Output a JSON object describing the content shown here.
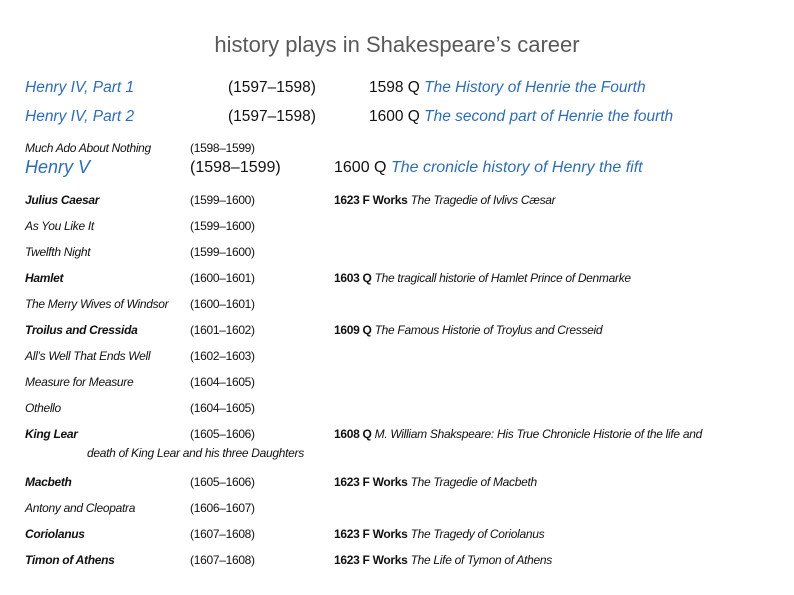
{
  "title": "history plays in Shakespeare’s career",
  "rows": [
    {
      "play": "Henry IV, Part 1",
      "years": "(1597–1598)",
      "prefix": "1598 Q",
      "source_title": "The History of Henrie the Fourth"
    },
    {
      "play": "Henry IV, Part 2",
      "years": "(1597–1598)",
      "prefix": "1600 Q",
      "source_title": "The second part of Henrie the fourth"
    },
    {
      "play": "Much Ado About Nothing",
      "years": "(1598–1599)",
      "prefix": "",
      "source_title": ""
    },
    {
      "play": "Henry V",
      "years": "(1598–1599)",
      "prefix": "1600 Q",
      "source_title": "The cronicle history of Henry the fift"
    },
    {
      "play": "Julius Caesar",
      "years": "(1599–1600)",
      "prefix": "1623 F Works",
      "source_title": "The Tragedie of Ivlivs Cæsar"
    },
    {
      "play": "As You Like It",
      "years": "(1599–1600)",
      "prefix": "",
      "source_title": ""
    },
    {
      "play": "Twelfth Night",
      "years": "(1599–1600)",
      "prefix": "",
      "source_title": ""
    },
    {
      "play": "Hamlet",
      "years": "(1600–1601)",
      "prefix": "1603 Q",
      "source_title": "The tragicall historie of Hamlet Prince of Denmarke"
    },
    {
      "play": "The Merry Wives of Windsor",
      "years": "(1600–1601)",
      "prefix": "",
      "source_title": ""
    },
    {
      "play": "Troilus and Cressida",
      "years": "(1601–1602)",
      "prefix": "1609 Q",
      "source_title": "The Famous Historie of Troylus and Cresseid"
    },
    {
      "play": "All’s Well That Ends Well",
      "years": "(1602–1603)",
      "prefix": "",
      "source_title": ""
    },
    {
      "play": "Measure for Measure",
      "years": "(1604–1605)",
      "prefix": "",
      "source_title": ""
    },
    {
      "play": "Othello",
      "years": "(1604–1605)",
      "prefix": "",
      "source_title": ""
    },
    {
      "play": "King Lear",
      "years": "(1605–1606)",
      "prefix": "1608 Q",
      "source_title": "M. William Shakspeare: His True Chronicle Historie of the life and"
    },
    {
      "play": "Macbeth",
      "years": "(1605–1606)",
      "prefix": "1623 F Works",
      "source_title": "The Tragedie of Macbeth"
    },
    {
      "play": "Antony and Cleopatra",
      "years": "(1606–1607)",
      "prefix": "",
      "source_title": ""
    },
    {
      "play": "Coriolanus",
      "years": "(1607–1608)",
      "prefix": "1623 F Works",
      "source_title": "The Tragedy of Coriolanus"
    },
    {
      "play": "Timon of Athens",
      "years": "(1607–1608)",
      "prefix": "1623 F Works",
      "source_title": "The Life of Tymon of Athens"
    }
  ],
  "king_lear_continuation": "death of King Lear and his three Daughters",
  "colors": {
    "accent": "#2e6db4",
    "title": "#595959"
  }
}
